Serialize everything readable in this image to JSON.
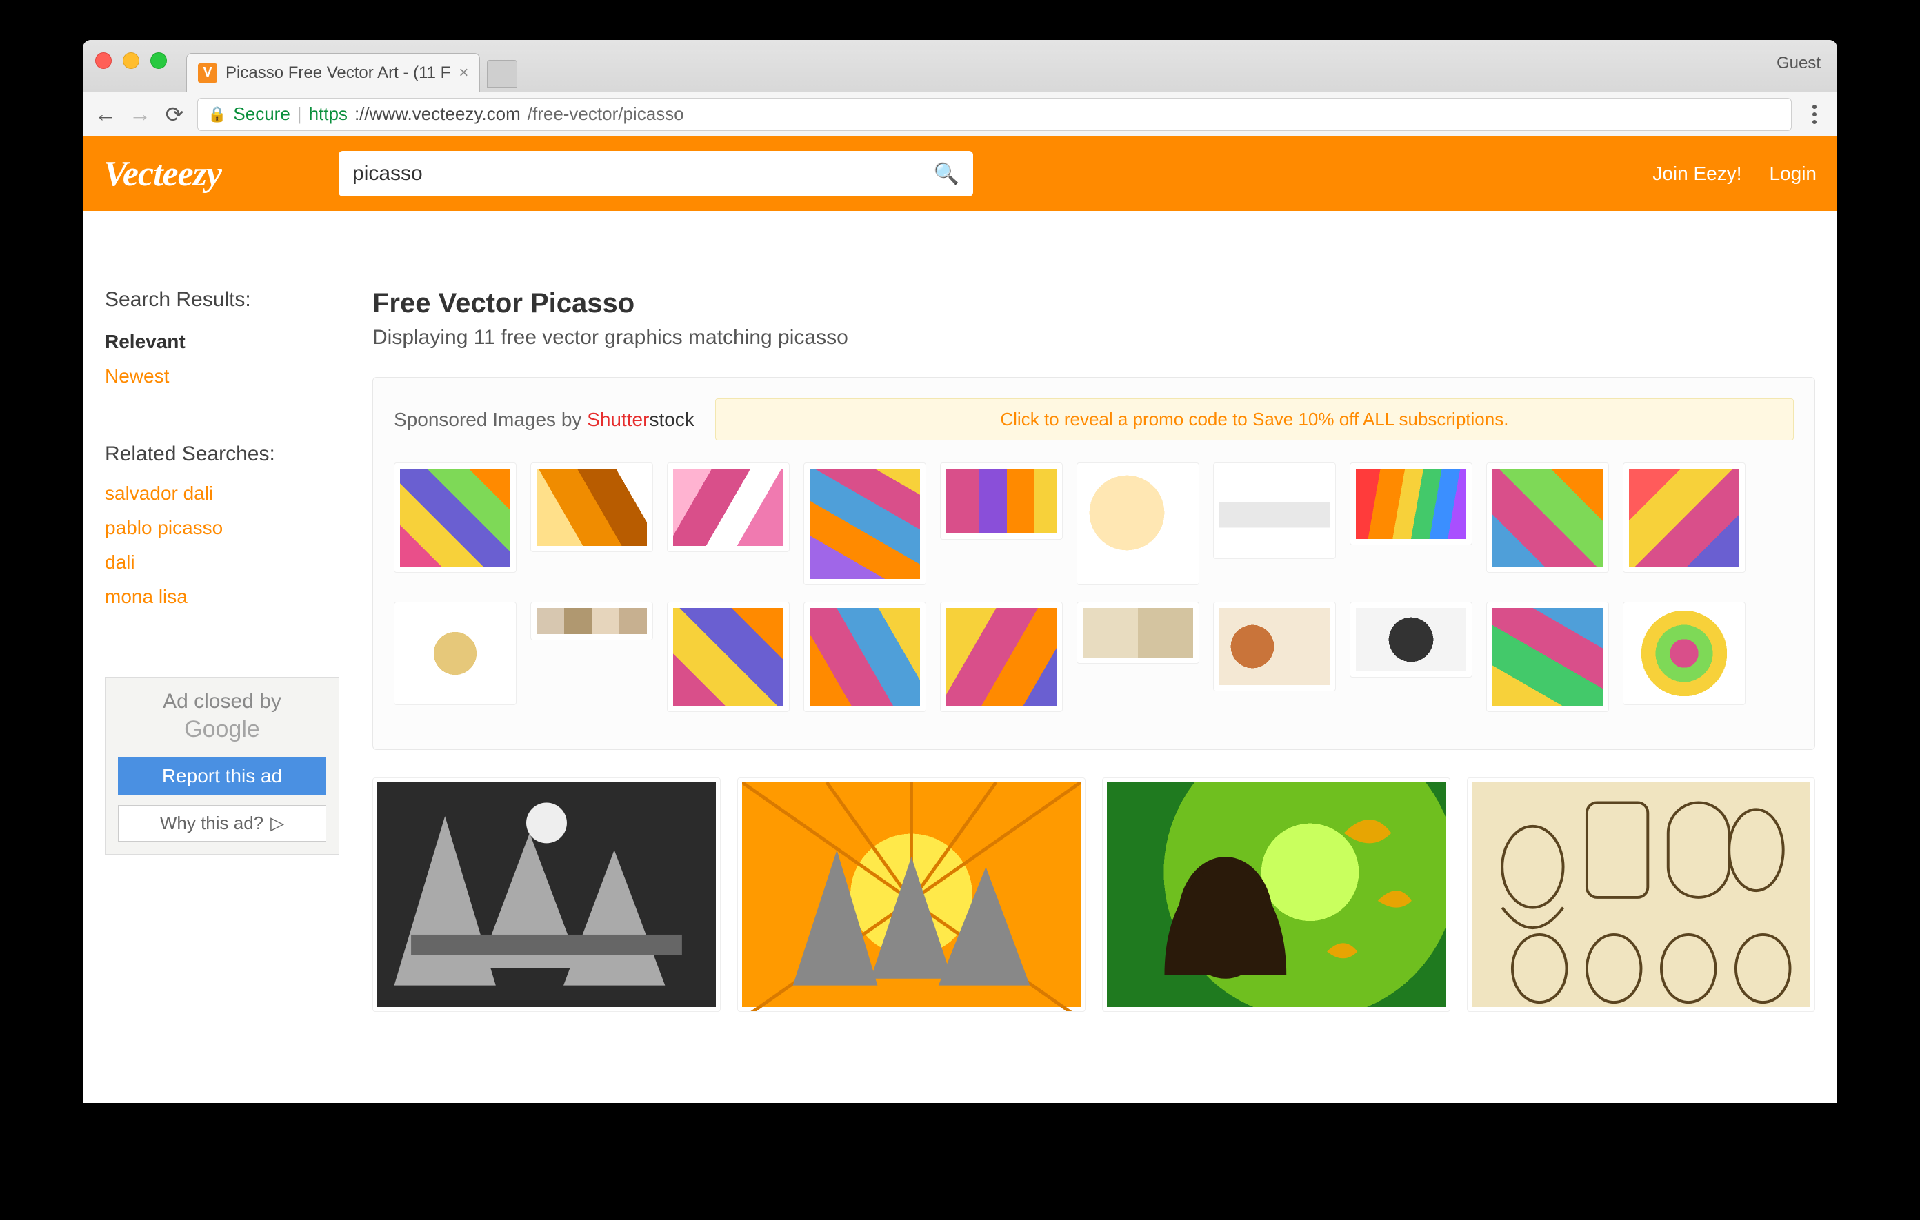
{
  "browser": {
    "tab_title": "Picasso Free Vector Art - (11 F",
    "guest_label": "Guest",
    "secure_label": "Secure",
    "url_protocol": "https",
    "url_host": "://www.vecteezy.com",
    "url_path": "/free-vector/picasso"
  },
  "header": {
    "logo": "Vecteezy",
    "search_value": "picasso",
    "join_label": "Join Eezy!",
    "login_label": "Login"
  },
  "sidebar": {
    "results_heading": "Search Results:",
    "sort_relevant": "Relevant",
    "sort_newest": "Newest",
    "related_heading": "Related Searches:",
    "related": [
      "salvador dali",
      "pablo picasso",
      "dali",
      "mona lisa"
    ],
    "ad": {
      "closed_line1": "Ad closed by",
      "closed_line2": "Google",
      "report_btn": "Report this ad",
      "why_btn": "Why this ad?"
    }
  },
  "main": {
    "title": "Free Vector Picasso",
    "subtitle": "Displaying 11 free vector graphics matching picasso",
    "sponsored_prefix": "Sponsored Images by ",
    "sponsored_brand1": "Shutter",
    "sponsored_brand2": "stock",
    "promo": "Click to reveal a promo code to Save 10% off ALL subscriptions."
  }
}
